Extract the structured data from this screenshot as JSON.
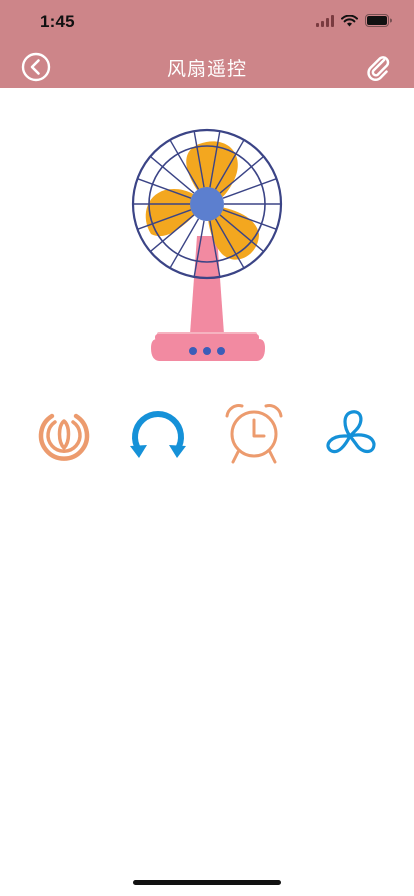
{
  "status_bar": {
    "time": "1:45"
  },
  "nav": {
    "title": "风扇遥控",
    "back_icon": "chevron-left-circle",
    "right_icon": "paperclip"
  },
  "controls": [
    {
      "icon": "power-icon",
      "color": "#ec9b6e"
    },
    {
      "icon": "rotate-icon",
      "color": "#1591d8"
    },
    {
      "icon": "alarm-clock-icon",
      "color": "#ec9b6e"
    },
    {
      "icon": "fan-blade-icon",
      "color": "#1591d8"
    }
  ],
  "colors": {
    "header": "#cd8589",
    "fan_blade": "#f3a71f",
    "fan_cage": "#3b4486",
    "fan_hub": "#5c7fcf",
    "fan_stand": "#f28aa1",
    "orange_icon": "#ec9b6e",
    "blue_icon": "#1591d8"
  }
}
